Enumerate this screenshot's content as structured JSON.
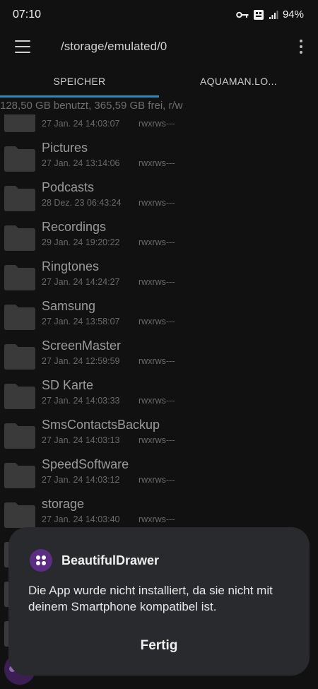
{
  "status": {
    "time": "07:10",
    "battery": "94%"
  },
  "toolbar": {
    "path": "/storage/emulated/0"
  },
  "tabs": [
    {
      "label": "SPEICHER",
      "active": true
    },
    {
      "label": "AQUAMAN.LO...",
      "active": false
    }
  ],
  "summary": "128,50 GB benutzt, 365,59 GB frei, r/w",
  "files": [
    {
      "name": "",
      "date": "27 Jan. 24 14:03:07",
      "perm": "rwxrws---"
    },
    {
      "name": "Pictures",
      "date": "27 Jan. 24 13:14:06",
      "perm": "rwxrws---"
    },
    {
      "name": "Podcasts",
      "date": "28 Dez. 23 06:43:24",
      "perm": "rwxrws---"
    },
    {
      "name": "Recordings",
      "date": "29 Jan. 24 19:20:22",
      "perm": "rwxrws---"
    },
    {
      "name": "Ringtones",
      "date": "27 Jan. 24 14:24:27",
      "perm": "rwxrws---"
    },
    {
      "name": "Samsung",
      "date": "27 Jan. 24 13:58:07",
      "perm": "rwxrws---"
    },
    {
      "name": "ScreenMaster",
      "date": "27 Jan. 24 12:59:59",
      "perm": "rwxrws---"
    },
    {
      "name": "SD Karte",
      "date": "27 Jan. 24 14:03:33",
      "perm": "rwxrws---"
    },
    {
      "name": "SmsContactsBackup",
      "date": "27 Jan. 24 14:03:13",
      "perm": "rwxrws---"
    },
    {
      "name": "SpeedSoftware",
      "date": "27 Jan. 24 14:03:12",
      "perm": "rwxrws---"
    },
    {
      "name": "storage",
      "date": "27 Jan. 24 14:03:40",
      "perm": "rwxrws---"
    }
  ],
  "dialog": {
    "app_name": "BeautifulDrawer",
    "message": "Die App wurde nicht installiert, da sie nicht mit deinem Smartphone kompatibel ist.",
    "button": "Fertig"
  },
  "icons": {
    "menu": "hamburger-icon",
    "more": "more-vert-icon",
    "folder": "folder-icon",
    "key": "vpn-key-icon",
    "signal": "signal-icon"
  },
  "colors": {
    "accent": "#2e89b8",
    "dialog_bg": "#292a2d",
    "app_icon": "#5b2d83"
  }
}
